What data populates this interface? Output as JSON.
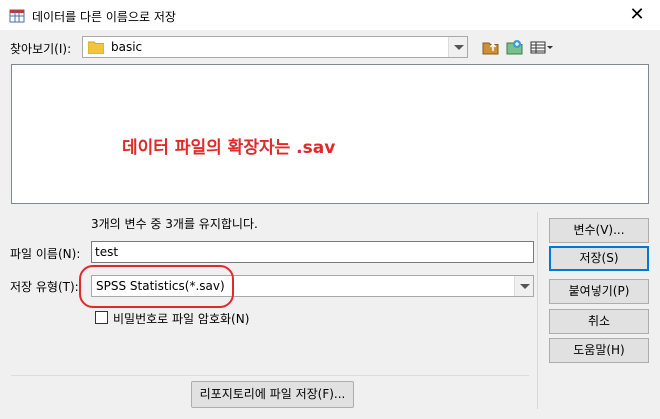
{
  "window": {
    "title": "데이터를 다른 이름으로 저장",
    "close_glyph": "✕"
  },
  "lookin": {
    "label": "찾아보기(I):",
    "value": "basic"
  },
  "toolbar": {
    "icons": [
      "up-folder-icon",
      "new-folder-icon",
      "view-menu-icon"
    ]
  },
  "annotation": {
    "text": "데이터 파일의 확장자는 .sav",
    "color": "#e02a2a"
  },
  "info": {
    "keep_text": "3개의 변수 중 3개를 유지합니다."
  },
  "filename": {
    "label": "파일 이름(N):",
    "value": "test"
  },
  "filetype": {
    "label": "저장 유형(T):",
    "value": "SPSS Statistics(*.sav)"
  },
  "encrypt": {
    "label": "비밀번호로 파일 암호화(N)",
    "checked": false
  },
  "buttons": {
    "variables": "변수(V)...",
    "save": "저장(S)",
    "paste": "붙여넣기(P)",
    "cancel": "취소",
    "help": "도움말(H)"
  },
  "repository": {
    "label": "리포지토리에 파일 저장(F)..."
  }
}
